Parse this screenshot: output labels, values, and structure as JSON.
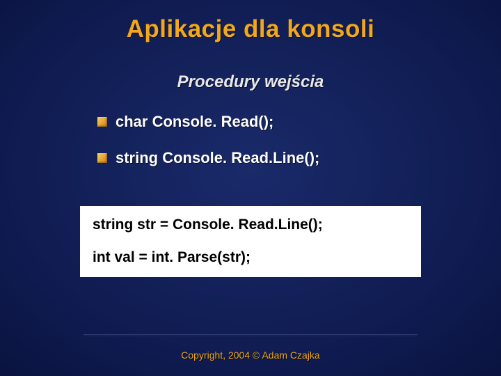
{
  "title": "Aplikacje dla konsoli",
  "subtitle": "Procedury wejścia",
  "bullets": [
    "char Console. Read();",
    "string Console. Read.Line();"
  ],
  "code": {
    "line1": "string str = Console. Read.Line();",
    "line2": "int val = int. Parse(str);"
  },
  "footer": "Copyright, 2004 © Adam Czajka"
}
